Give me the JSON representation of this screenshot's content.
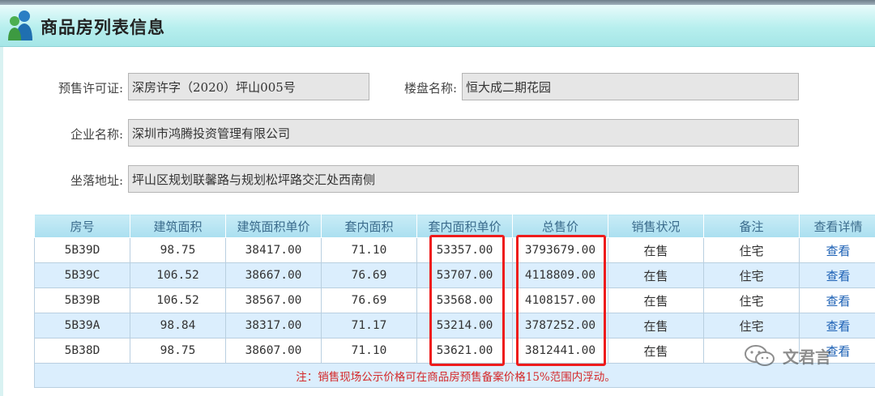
{
  "header": {
    "title": "商品房列表信息"
  },
  "form": {
    "permit_label": "预售许可证:",
    "permit_value": "深房许字（2020）坪山005号",
    "project_label": "楼盘名称:",
    "project_value": "恒大成二期花园",
    "company_label": "企业名称:",
    "company_value": "深圳市鸿腾投资管理有限公司",
    "address_label": "坐落地址:",
    "address_value": "坪山区规划联馨路与规划松坪路交汇处西南侧"
  },
  "table": {
    "columns": [
      "房号",
      "建筑面积",
      "建筑面积单价",
      "套内面积",
      "套内面积单价",
      "总售价",
      "销售状况",
      "备注",
      "查看详情"
    ],
    "rows": [
      [
        "5B39D",
        "98.75",
        "38417.00",
        "71.10",
        "53357.00",
        "3793679.00",
        "在售",
        "住宅",
        "查看"
      ],
      [
        "5B39C",
        "106.52",
        "38667.00",
        "76.69",
        "53707.00",
        "4118809.00",
        "在售",
        "住宅",
        "查看"
      ],
      [
        "5B39B",
        "106.52",
        "38567.00",
        "76.69",
        "53568.00",
        "4108157.00",
        "在售",
        "住宅",
        "查看"
      ],
      [
        "5B39A",
        "98.84",
        "38317.00",
        "71.17",
        "53214.00",
        "3787252.00",
        "在售",
        "住宅",
        "查看"
      ],
      [
        "5B38D",
        "98.75",
        "38607.00",
        "71.10",
        "53621.00",
        "3812441.00",
        "在售",
        "",
        "查看"
      ]
    ],
    "note": "注：销售现场公示价格可在商品房预售备案价格15%范围内浮动。"
  },
  "watermark": {
    "text": "文君言",
    "icon": "wechat-icon"
  },
  "colors": {
    "header_bg": "#b7efee",
    "alt_row": "#dbeefd",
    "highlight": "#ee1c1c",
    "link": "#1a5fb4",
    "note": "#d42a2a"
  }
}
